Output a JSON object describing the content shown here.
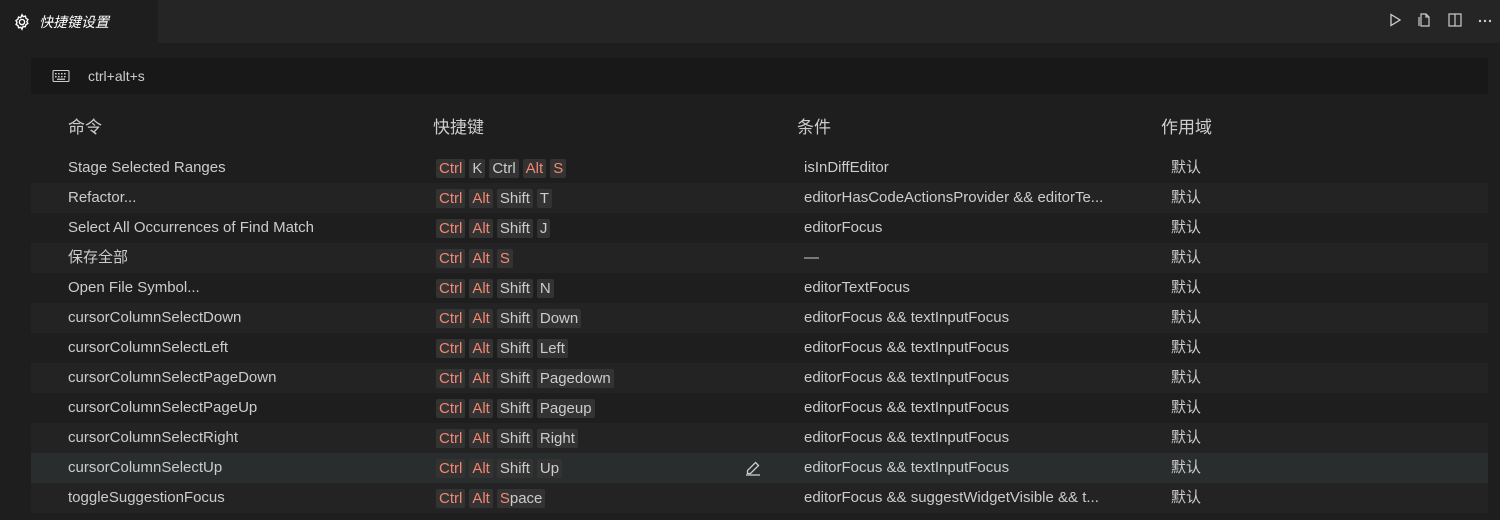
{
  "tab": {
    "label": "快捷键设置",
    "icon": "gear-icon"
  },
  "actions": [
    {
      "name": "run-icon"
    },
    {
      "name": "open-json-icon"
    },
    {
      "name": "split-editor-icon"
    },
    {
      "name": "more-icon"
    }
  ],
  "search": {
    "value": "ctrl+alt+s",
    "icon": "keyboard-icon"
  },
  "headers": {
    "command": "命令",
    "keybinding": "快捷键",
    "when": "条件",
    "source": "作用域"
  },
  "rows": [
    {
      "command": "Stage Selected Ranges",
      "keys": [
        {
          "k": "Ctrl",
          "hl": true
        },
        {
          "k": "K",
          "hl": false
        },
        {
          "k": "Ctrl",
          "hl": false
        },
        {
          "k": "Alt",
          "hl": true
        },
        {
          "k": "S",
          "hl": true
        }
      ],
      "when": "isInDiffEditor",
      "source": "默认"
    },
    {
      "command": "Refactor...",
      "keys": [
        {
          "k": "Ctrl",
          "hl": true
        },
        {
          "k": "Alt",
          "hl": true
        },
        {
          "k": "Shift",
          "hl": false
        },
        {
          "k": "T",
          "hl": false
        }
      ],
      "when": "editorHasCodeActionsProvider && editorTe...",
      "source": "默认"
    },
    {
      "command": "Select All Occurrences of Find Match",
      "keys": [
        {
          "k": "Ctrl",
          "hl": true
        },
        {
          "k": "Alt",
          "hl": true
        },
        {
          "k": "Shift",
          "hl": false
        },
        {
          "k": "J",
          "hl": false
        }
      ],
      "when": "editorFocus",
      "source": "默认"
    },
    {
      "command": "保存全部",
      "keys": [
        {
          "k": "Ctrl",
          "hl": true
        },
        {
          "k": "Alt",
          "hl": true
        },
        {
          "k": "S",
          "hl": true
        }
      ],
      "when": "—",
      "source": "默认"
    },
    {
      "command": "Open File Symbol...",
      "keys": [
        {
          "k": "Ctrl",
          "hl": true
        },
        {
          "k": "Alt",
          "hl": true
        },
        {
          "k": "Shift",
          "hl": false
        },
        {
          "k": "N",
          "hl": false
        }
      ],
      "when": "editorTextFocus",
      "source": "默认"
    },
    {
      "command": "cursorColumnSelectDown",
      "keys": [
        {
          "k": "Ctrl",
          "hl": true
        },
        {
          "k": "Alt",
          "hl": true
        },
        {
          "k": "Shift",
          "hl": false
        },
        {
          "k": "Down",
          "hl": false
        }
      ],
      "when": "editorFocus && textInputFocus",
      "source": "默认"
    },
    {
      "command": "cursorColumnSelectLeft",
      "keys": [
        {
          "k": "Ctrl",
          "hl": true
        },
        {
          "k": "Alt",
          "hl": true
        },
        {
          "k": "Shift",
          "hl": false
        },
        {
          "k": "Left",
          "hl": false
        }
      ],
      "when": "editorFocus && textInputFocus",
      "source": "默认"
    },
    {
      "command": "cursorColumnSelectPageDown",
      "keys": [
        {
          "k": "Ctrl",
          "hl": true
        },
        {
          "k": "Alt",
          "hl": true
        },
        {
          "k": "Shift",
          "hl": false
        },
        {
          "k": "Pagedown",
          "hl": false
        }
      ],
      "when": "editorFocus && textInputFocus",
      "source": "默认"
    },
    {
      "command": "cursorColumnSelectPageUp",
      "keys": [
        {
          "k": "Ctrl",
          "hl": true
        },
        {
          "k": "Alt",
          "hl": true
        },
        {
          "k": "Shift",
          "hl": false
        },
        {
          "k": "Pageup",
          "hl": false
        }
      ],
      "when": "editorFocus && textInputFocus",
      "source": "默认"
    },
    {
      "command": "cursorColumnSelectRight",
      "keys": [
        {
          "k": "Ctrl",
          "hl": true
        },
        {
          "k": "Alt",
          "hl": true
        },
        {
          "k": "Shift",
          "hl": false
        },
        {
          "k": "Right",
          "hl": false
        }
      ],
      "when": "editorFocus && textInputFocus",
      "source": "默认"
    },
    {
      "command": "cursorColumnSelectUp",
      "keys": [
        {
          "k": "Ctrl",
          "hl": true
        },
        {
          "k": "Alt",
          "hl": true
        },
        {
          "k": "Shift",
          "hl": false
        },
        {
          "k": "Up",
          "hl": false
        }
      ],
      "when": "editorFocus && textInputFocus",
      "source": "默认",
      "selected": true
    },
    {
      "command": "toggleSuggestionFocus",
      "keys": [
        {
          "k": "Ctrl",
          "hl": true
        },
        {
          "k": "Alt",
          "hl": true
        },
        {
          "k": "S",
          "hl": true
        },
        {
          "k": "pace",
          "hl": false,
          "join": true
        }
      ],
      "when": "editorFocus && suggestWidgetVisible && t...",
      "source": "默认"
    }
  ],
  "colors": {
    "highlight": "#f48771",
    "background": "#1e1e1e",
    "selected_row": "#2a2d2e"
  }
}
